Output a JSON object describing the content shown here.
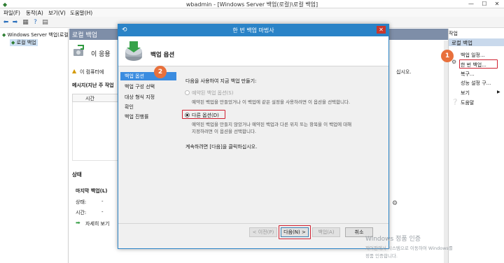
{
  "window": {
    "title": "wbadmin - [Windows Server 백업(로컬)\\로컬 백업]",
    "min": "—",
    "max": "☐",
    "close": "✕"
  },
  "menu": [
    "파일(F)",
    "동작(A)",
    "보기(V)",
    "도움말(H)"
  ],
  "tree": {
    "root": "Windows Server 백업(로컬",
    "child": "로컬 백업"
  },
  "center": {
    "header": "로컬 백업",
    "subtitle": "이 응용",
    "warning": "이 컴퓨터에",
    "warning_tail": "십시오.",
    "messages_label": "메시지(지난 주 작업",
    "time_col": "시간",
    "status_header": "상태",
    "last_backup_label": "마지막 백업(L)",
    "state_label": "상태:",
    "state_value": "-",
    "time_label": "시간:",
    "time_value": "-",
    "details_link": "자세히 보기"
  },
  "actions": {
    "header": "작업",
    "section": "로컬 백업",
    "items": [
      "백업 일정...",
      "한 번 백업...",
      "복구...",
      "성능 설정 구...",
      "보기",
      "도움말"
    ]
  },
  "dialog": {
    "title": "한 번 백업 마법사",
    "close": "✕",
    "header_title": "백업 옵션",
    "steps": [
      "백업 옵션",
      "백업 구성 선택",
      "대상 형식 지정",
      "확인",
      "백업 진행률"
    ],
    "question": "다음을 사용하여 지금 백업 만들기:",
    "option1_label": "예약된 백업 옵션(S)",
    "option1_desc": "예약된 백업을 만들었거나 이 백업에 같은 설정을 사용하려면 이 옵션을 선택합니다.",
    "option2_label": "다른 옵션(D)",
    "option2_desc_line1": "예약된 백업을 만들지 않았거나 예약된 백업과 다른 위치 또는 항목을 이 백업에 대해",
    "option2_desc_line2": "지정하려면 이 옵션을 선택합니다.",
    "continue_text": "계속하려면 [다음]을 클릭하십시오.",
    "buttons": {
      "prev": "< 이전(P)",
      "next": "다음(N) >",
      "backup": "백업(A)",
      "cancel": "취소"
    }
  },
  "badges": {
    "one": "1",
    "two": "2"
  },
  "watermark": {
    "line1": "Windows 정품 인증",
    "line2": "제어판에서 시스템으로 이동하여 Windows를",
    "line3": "정품 인증합니다."
  },
  "colors": {
    "accent": "#2a83c7",
    "header": "#7e8ea8",
    "badge": "#e8703c",
    "highlight": "#d02030"
  }
}
